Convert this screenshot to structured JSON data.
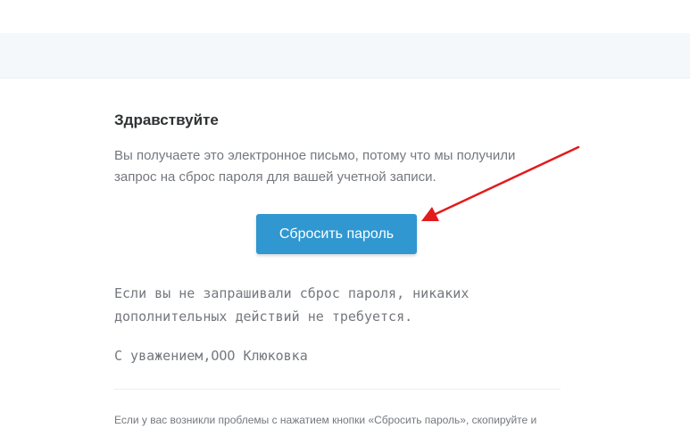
{
  "email": {
    "greeting": "Здравствуйте",
    "intro": "Вы получаете это электронное письмо, потому что мы получили запрос на сброс пароля для вашей учетной записи.",
    "button_label": "Сбросить пароль",
    "note_lines": [
      "Если вы не запрашивали сброс пароля, никаких",
      "дополнительных действий не требуется."
    ],
    "signature": "С уважением,ООО Клюковка",
    "trouble_text": "Если у вас возникли проблемы с нажатием кнопки «Сбросить пароль», скопируйте и"
  },
  "colors": {
    "button": "#3097d1",
    "arrow": "#e21b1b",
    "header_band": "#f5f8fa",
    "text_muted": "#74787e",
    "text_heading": "#2f3133"
  }
}
